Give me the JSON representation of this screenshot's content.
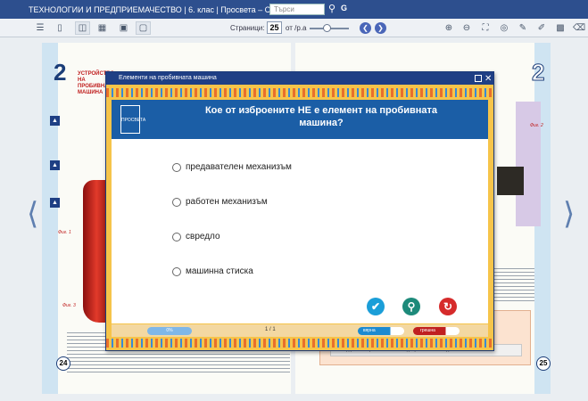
{
  "window": {
    "title": "ТЕХНОЛОГИИ И ПРЕДПРИЕМАЧЕСТВО | 6. клас | Просвета – София",
    "search_placeholder": "Търси"
  },
  "toolbar": {
    "page_label": "Страници:",
    "page_value": "25",
    "page_of": "от /р.а"
  },
  "book": {
    "left_page_big": "2",
    "right_page_big": "2",
    "left_page_number": "24",
    "right_page_number": "25",
    "left_heading": "УСТРОЙСТВО НА ПРОБИВНАТА МАШИНА",
    "fig_label_1": "Фиг. 1",
    "fig_label_2": "Фиг. 3",
    "right_fig_label": "Фиг. 2",
    "right_bottom_text": "• След работа с ръчна машинка и добри ъглите на изделието"
  },
  "dialog": {
    "title": "Елементи на пробивната машина",
    "logo_text": "ПРОСВЕТА",
    "question": "Кое от изброените НЕ е елемент на пробивната машина?",
    "options": [
      "предавателен механизъм",
      "работен механизъм",
      "свредло",
      "машинна стиска"
    ],
    "progress_percent": "0%",
    "question_counter": "1 / 1",
    "correct_label": "вярна",
    "wrong_label": "грешна"
  },
  "colors": {
    "header_blue": "#1f3f85",
    "question_blue": "#1b5ea6",
    "frame_yellow": "#f6c44a",
    "check_button": "#1b9ed8",
    "hint_button": "#1d8a7a",
    "reset_button": "#d62b2b"
  }
}
